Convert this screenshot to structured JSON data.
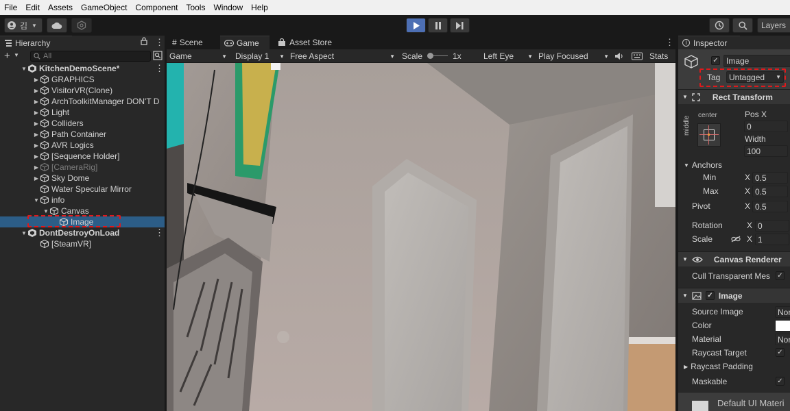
{
  "menu": [
    "File",
    "Edit",
    "Assets",
    "GameObject",
    "Component",
    "Tools",
    "Window",
    "Help"
  ],
  "toolbar": {
    "account_label": "김",
    "history_icon": "history-icon",
    "search_icon": "search-icon",
    "layers_label": "Layers"
  },
  "hierarchy": {
    "tab_label": "Hierarchy",
    "search_placeholder": "All",
    "items": [
      {
        "label": "KitchenDemoScene*",
        "depth": 0,
        "type": "scene",
        "expanded": true
      },
      {
        "label": "GRAPHICS",
        "depth": 1,
        "arrow": "right"
      },
      {
        "label": "VisitorVR(Clone)",
        "depth": 1,
        "arrow": "right"
      },
      {
        "label": "ArchToolkitManager DON'T D",
        "depth": 1,
        "arrow": "right"
      },
      {
        "label": "Light",
        "depth": 1,
        "arrow": "right"
      },
      {
        "label": "Colliders",
        "depth": 1,
        "arrow": "right"
      },
      {
        "label": "Path Container",
        "depth": 1,
        "arrow": "right"
      },
      {
        "label": "AVR Logics",
        "depth": 1,
        "arrow": "right"
      },
      {
        "label": "[Sequence Holder]",
        "depth": 1,
        "arrow": "right"
      },
      {
        "label": "[CameraRig]",
        "depth": 1,
        "arrow": "right",
        "dim": true
      },
      {
        "label": "Sky Dome",
        "depth": 1,
        "arrow": "right"
      },
      {
        "label": "Water Specular Mirror",
        "depth": 1,
        "arrow": ""
      },
      {
        "label": "info",
        "depth": 1,
        "arrow": "down"
      },
      {
        "label": "Canvas",
        "depth": 2,
        "arrow": "down"
      },
      {
        "label": "Image",
        "depth": 3,
        "arrow": "",
        "selected": true
      },
      {
        "label": "DontDestroyOnLoad",
        "depth": 0,
        "type": "scene",
        "expanded": true
      },
      {
        "label": "[SteamVR]",
        "depth": 1,
        "arrow": ""
      }
    ]
  },
  "game": {
    "tabs": [
      "Scene",
      "Game",
      "Asset Store"
    ],
    "mode": "Game",
    "display": "Display 1",
    "aspect": "Free Aspect",
    "scale_label": "Scale",
    "scale_value": "1x",
    "eye": "Left Eye",
    "focus": "Play Focused",
    "stats": "Stats"
  },
  "inspector": {
    "tab_label": "Inspector",
    "object_name": "Image",
    "tag_label": "Tag",
    "tag_value": "Untagged",
    "rect_transform": {
      "title": "Rect Transform",
      "anchor_h": "center",
      "anchor_v": "middle",
      "posx_label": "Pos X",
      "posx_value": "0",
      "width_label": "Width",
      "width_value": "100",
      "anchors_label": "Anchors",
      "min_label": "Min",
      "min_x": "0.5",
      "max_label": "Max",
      "max_x": "0.5",
      "pivot_label": "Pivot",
      "pivot_x": "0.5",
      "rotation_label": "Rotation",
      "rotation_x": "0",
      "scale_label": "Scale",
      "scale_x": "1",
      "x_label": "X"
    },
    "canvas_renderer": {
      "title": "Canvas Renderer",
      "cull_label": "Cull Transparent Mes"
    },
    "image": {
      "title": "Image",
      "source_label": "Source Image",
      "source_value": "Nor",
      "color_label": "Color",
      "material_label": "Material",
      "material_value": "Nor",
      "raycast_label": "Raycast Target",
      "padding_label": "Raycast Padding",
      "maskable_label": "Maskable"
    },
    "material_preview": "Default UI Materi"
  },
  "colors": {
    "selection": "#2c5d87",
    "highlight_box": "#e0191b",
    "play_active": "#4d6fb4"
  }
}
